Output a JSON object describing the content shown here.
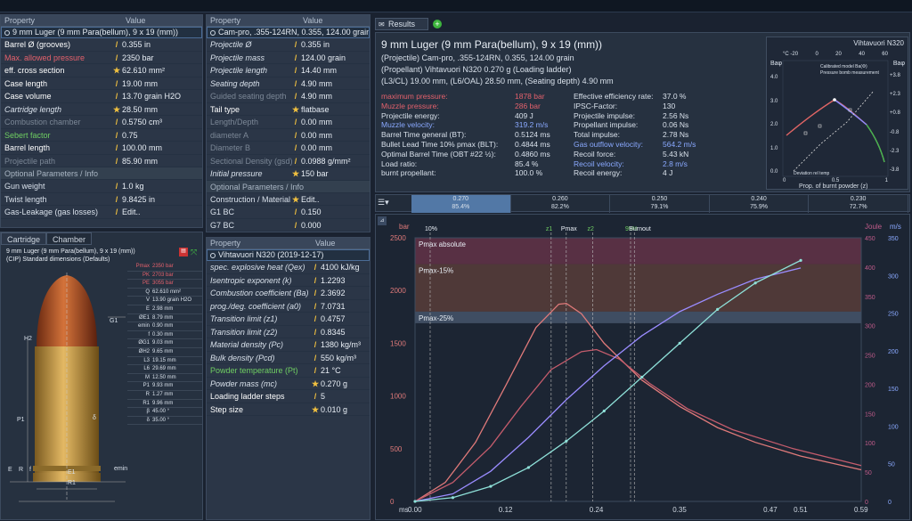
{
  "cartridge_panel": {
    "header": {
      "property": "Property",
      "value": "Value"
    },
    "selector": "9 mm Luger (9 mm Para(bellum), 9 x 19 (mm))",
    "rows": [
      {
        "label": "Barrel Ø (grooves)",
        "value": "0.355 in",
        "style": "white"
      },
      {
        "label": "Max. allowed pressure",
        "value": "2350 bar",
        "style": "red"
      },
      {
        "label": "eff. cross section",
        "value": "62.610 mm²",
        "style": "white"
      },
      {
        "label": "Case length",
        "value": "19.00 mm",
        "style": "white"
      },
      {
        "label": "Case volume",
        "value": "13.70 grain H2O",
        "style": "white"
      },
      {
        "label": "Cartridge length",
        "value": "28.50 mm",
        "style": "it"
      },
      {
        "label": "Combustion chamber",
        "value": "0.5750 cm³",
        "style": "grey"
      },
      {
        "label": "Sebert factor",
        "value": "0.75",
        "style": "green"
      },
      {
        "label": "Barrel length",
        "value": "100.00 mm",
        "style": "white"
      },
      {
        "label": "Projectile path",
        "value": "85.90 mm",
        "style": "grey"
      }
    ],
    "section": "Optional Parameters / Info",
    "opt_rows": [
      {
        "label": "Gun weight",
        "value": "1.0 kg"
      },
      {
        "label": "Twist length",
        "value": "9.8425 in"
      },
      {
        "label": "Gas-Leakage (gas losses)",
        "value": "Edit.."
      }
    ]
  },
  "projectile_panel": {
    "header": {
      "property": "Property",
      "value": "Value"
    },
    "selector": "Cam-pro, .355-124RN, 0.355, 124.00 grain",
    "rows": [
      {
        "label": "Projectile Ø",
        "value": "0.355 in",
        "style": "it"
      },
      {
        "label": "Projectile mass",
        "value": "124.00 grain",
        "style": "it"
      },
      {
        "label": "Projectile length",
        "value": "14.40 mm",
        "style": "it"
      },
      {
        "label": "Seating depth",
        "value": "4.90 mm",
        "style": "it"
      },
      {
        "label": "Guided seating depth",
        "value": "4.90 mm",
        "style": "grey"
      },
      {
        "label": "Tail type",
        "value": "flatbase",
        "style": "white"
      },
      {
        "label": "Length/Depth",
        "value": "0.00 mm",
        "style": "grey"
      },
      {
        "label": "diameter A",
        "value": "0.00 mm",
        "style": "grey"
      },
      {
        "label": "Diameter B",
        "value": "0.00 mm",
        "style": "grey"
      },
      {
        "label": "Sectional Density (gsd)",
        "value": "0.0988 g/mm²",
        "style": "grey"
      },
      {
        "label": "Initial pressure",
        "value": "150 bar",
        "style": "it"
      }
    ],
    "section": "Optional Parameters / Info",
    "opt_rows": [
      {
        "label": "Construction / Material",
        "value": "Edit.."
      },
      {
        "label": "G1 BC",
        "value": "0.150"
      },
      {
        "label": "G7 BC",
        "value": "0.000"
      }
    ]
  },
  "powder_panel": {
    "header": {
      "property": "Property",
      "value": "Value"
    },
    "selector": "Vihtavuori N320 (2019-12-17)",
    "rows": [
      {
        "label": "spec. explosive heat (Qex)",
        "value": "4100 kJ/kg",
        "style": "it"
      },
      {
        "label": "Isentropic exponent (k)",
        "value": "1.2293",
        "style": "it"
      },
      {
        "label": "Combustion coefficient (Ba)",
        "value": "2.3692",
        "style": "it"
      },
      {
        "label": "prog./deg. coefficient (a0)",
        "value": "7.0731",
        "style": "it"
      },
      {
        "label": "Transition limit (z1)",
        "value": "0.4757",
        "style": "it"
      },
      {
        "label": "Transition limit (z2)",
        "value": "0.8345",
        "style": "it"
      },
      {
        "label": "Material density (Pc)",
        "value": "1380 kg/m³",
        "style": "it"
      },
      {
        "label": "Bulk density (Pcd)",
        "value": "550 kg/m³",
        "style": "it"
      },
      {
        "label": "Powder temperature (Pt)",
        "value": "21 °C",
        "style": "green"
      },
      {
        "label": "Powder mass (mc)",
        "value": "0.270 g",
        "style": "it"
      },
      {
        "label": "Loading ladder steps",
        "value": "5",
        "style": "white"
      },
      {
        "label": "Step size",
        "value": "0.010 g",
        "style": "white"
      }
    ]
  },
  "tabs": {
    "cartridge": "Cartridge",
    "chamber": "Chamber",
    "results": "Results"
  },
  "drawing": {
    "title1": "9 mm Luger (9 mm Para(bellum), 9 x 19 (mm))",
    "title2": "(CIP) Standard dimensions (Defaults)",
    "dims": [
      [
        "Pmax",
        "2350 bar"
      ],
      [
        "PK",
        "2703 bar"
      ],
      [
        "PE",
        "3055 bar"
      ],
      [
        "Q",
        "62.610 mm²"
      ],
      [
        "V",
        "13.90 grain H2O"
      ],
      [
        "E",
        "2.98 mm"
      ],
      [
        "ØE1",
        "8.79 mm"
      ],
      [
        "emin",
        "0.90 mm"
      ],
      [
        "f",
        "0.30 mm"
      ],
      [
        "ØG1",
        "9.03 mm"
      ],
      [
        "ØH2",
        "9.65 mm"
      ],
      [
        "L3",
        "19.15 mm"
      ],
      [
        "L6",
        "29.69 mm"
      ],
      [
        "M",
        "12.50 mm"
      ],
      [
        "P1",
        "9.93 mm"
      ],
      [
        "R",
        "1.27 mm"
      ],
      [
        "R1",
        "9.96 mm"
      ],
      [
        "β",
        "45.00 °"
      ],
      [
        "δ",
        "35.00 °"
      ]
    ],
    "labels": {
      "g1": "G1",
      "h2": "H2",
      "p1": "P1",
      "e1": "E1",
      "r1": "R1",
      "emin": "emin",
      "delta": "δ",
      "bottom_e": "E",
      "bottom_r": "R",
      "bottom_f": "f"
    }
  },
  "results": {
    "line1": "9 mm Luger (9 mm Para(bellum), 9 x 19 (mm))",
    "line2": "(Projectile) Cam-pro, .355-124RN, 0.355, 124.00 grain",
    "line3": "(Propellant) Vihtavuori N320 0.270 g (Loading ladder)",
    "line4": "(L3/CL) 19.00 mm, (L6/OAL) 28.50 mm, (Seating depth) 4.90 mm",
    "left": [
      {
        "label": "maximum pressure:",
        "value": "1878 bar",
        "style": "red"
      },
      {
        "label": "Muzzle pressure:",
        "value": "286 bar",
        "style": "red"
      },
      {
        "label": "Projectile energy:",
        "value": "409 J",
        "style": "white"
      },
      {
        "label": "Muzzle velocity:",
        "value": "319.2 m/s",
        "style": "blue"
      },
      {
        "label": "Barrel Time general (BT):",
        "value": "0.5124 ms",
        "style": "white"
      },
      {
        "label": "Bullet Lead Time 10% pmax (BLT):",
        "value": "0.4844 ms",
        "style": "white"
      },
      {
        "label": "Optimal Barrel Time (OBT #22 ½):",
        "value": "0.4860 ms",
        "style": "white"
      },
      {
        "label": "Load ratio:",
        "value": "85.4 %",
        "style": "white"
      },
      {
        "label": "burnt propellant:",
        "value": "100.0 %",
        "style": "white"
      }
    ],
    "right": [
      {
        "label": "Effective efficiency rate:",
        "value": "37.0 %",
        "style": "white"
      },
      {
        "label": "IPSC-Factor:",
        "value": "130",
        "style": "white"
      },
      {
        "label": "Projectile impulse:",
        "value": "2.56 Ns",
        "style": "white"
      },
      {
        "label": "Propellant impulse:",
        "value": "0.06 Ns",
        "style": "white"
      },
      {
        "label": "Total impulse:",
        "value": "2.78 Ns",
        "style": "white"
      },
      {
        "label": "Gas outflow velocity:",
        "value": "564.2 m/s",
        "style": "blue"
      },
      {
        "label": "Recoil force:",
        "value": "5.43 kN",
        "style": "white"
      },
      {
        "label": "Recoil velocity:",
        "value": "2.8 m/s",
        "style": "blue"
      },
      {
        "label": "Recoil energy:",
        "value": "4 J",
        "style": "white"
      }
    ],
    "ladder": [
      {
        "mass": "0.270",
        "pct": "85.4%",
        "progress": 0.854
      },
      {
        "mass": "0.260",
        "pct": "82.2%",
        "progress": 0.822
      },
      {
        "mass": "0.250",
        "pct": "79.1%",
        "progress": 0.791
      },
      {
        "mass": "0.240",
        "pct": "75.9%",
        "progress": 0.759
      },
      {
        "mass": "0.230",
        "pct": "72.7%",
        "progress": 0.727
      }
    ]
  },
  "mini_chart": {
    "title": "Vihtavuori N320",
    "legend": [
      "Calibrated model Ba(Φ)",
      "Pressure bomb measurement"
    ],
    "deviation_label": "Deviation rel temp",
    "xlabel": "Prop. of burnt powder (z)",
    "top_ticks": [
      "°C -20",
      "0",
      "20",
      "40",
      "60"
    ],
    "left_label": "Baφ",
    "right_label": "Baφ",
    "left_ticks": [
      "4.0",
      "3.0",
      "2.0",
      "1.0",
      "0.0"
    ],
    "right_ticks": [
      "+3.8",
      "+2.3",
      "+0.8",
      "-0.8",
      "-2.3",
      "-3.8"
    ],
    "bottom_ticks": [
      "0",
      "0.5",
      "1"
    ]
  },
  "chart_data": {
    "type": "line",
    "xlabel": "ms",
    "ylabel_left": "bar",
    "ylabel_right1": "Joule",
    "ylabel_right2": "m/s",
    "x_ticks": [
      "0.00",
      "0.12",
      "0.24",
      "0.35",
      "0.47",
      "0.51",
      "0.59"
    ],
    "xlim": [
      0,
      0.59
    ],
    "y_left_ticks": [
      0,
      500,
      1000,
      1500,
      2000,
      2500
    ],
    "ylim_left": [
      0,
      2500
    ],
    "y_joule_ticks": [
      0,
      50,
      100,
      150,
      200,
      250,
      300,
      350,
      400,
      450
    ],
    "y_ms_ticks": [
      0,
      50,
      100,
      150,
      200,
      250,
      300,
      350
    ],
    "ylim_ms": [
      0,
      350
    ],
    "bands": [
      {
        "label": "Pmax absolute",
        "from": 2250,
        "to": 2500,
        "color": "#8a3a52"
      },
      {
        "label": "Pmax-15%",
        "from": 1800,
        "to": 2250,
        "color": "#7a4a3c"
      },
      {
        "label": "Pmax-25%",
        "from": 1690,
        "to": 1800,
        "color": "#5d6f88"
      }
    ],
    "markers": [
      {
        "label": "10%",
        "x": 0.02
      },
      {
        "label": "z1",
        "x": 0.18
      },
      {
        "label": "Pmax",
        "x": 0.2
      },
      {
        "label": "z2",
        "x": 0.235
      },
      {
        "label": "95%",
        "x": 0.285
      },
      {
        "label": "Burnout",
        "x": 0.29
      }
    ],
    "series": [
      {
        "name": "",
        "color": "#e07a7a",
        "x": [
          0,
          0.04,
          0.08,
          0.12,
          0.16,
          0.19,
          0.2,
          0.22,
          0.25,
          0.3,
          0.35,
          0.4,
          0.45,
          0.51,
          0.59
        ],
        "y": [
          0,
          180,
          560,
          1100,
          1650,
          1870,
          1878,
          1780,
          1500,
          1150,
          900,
          700,
          560,
          430,
          300
        ]
      },
      {
        "name": "",
        "color": "#c45c6c",
        "x": [
          0,
          0.05,
          0.1,
          0.14,
          0.18,
          0.22,
          0.24,
          0.27,
          0.31,
          0.36,
          0.42,
          0.5,
          0.59
        ],
        "y": [
          0,
          180,
          520,
          900,
          1250,
          1420,
          1440,
          1350,
          1120,
          880,
          680,
          500,
          340
        ]
      },
      {
        "name": "",
        "color": "#9a8cff",
        "x": [
          0,
          0.05,
          0.1,
          0.15,
          0.2,
          0.25,
          0.3,
          0.35,
          0.4,
          0.45,
          0.51
        ],
        "y": [
          0,
          10,
          40,
          85,
          135,
          180,
          220,
          252,
          275,
          295,
          310
        ]
      },
      {
        "name": "",
        "color": "#8ee0d8",
        "x": [
          0,
          0.05,
          0.1,
          0.15,
          0.2,
          0.25,
          0.3,
          0.35,
          0.4,
          0.45,
          0.51
        ],
        "y": [
          0,
          5,
          20,
          45,
          80,
          120,
          165,
          210,
          255,
          290,
          320
        ]
      }
    ]
  }
}
